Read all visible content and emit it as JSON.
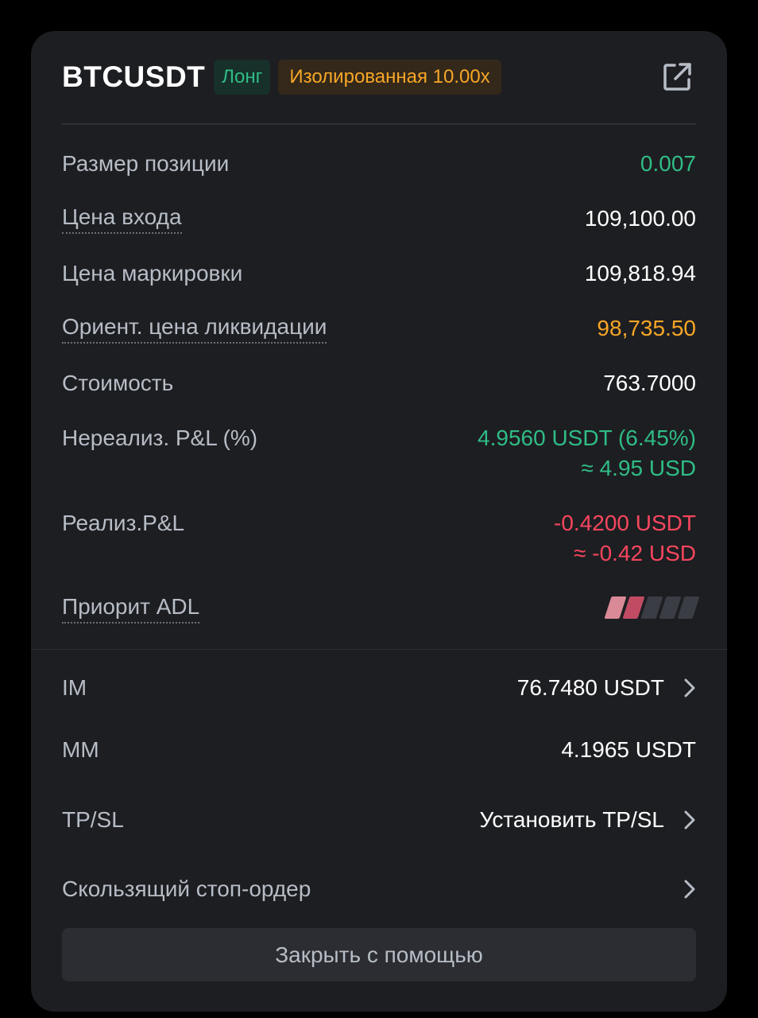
{
  "header": {
    "symbol": "BTCUSDT",
    "side_badge": "Лонг",
    "margin_badge": "Изолированная 10.00x",
    "share_icon": "share-external-icon"
  },
  "details": {
    "position_size": {
      "label": "Размер позиции",
      "value": "0.007"
    },
    "entry_price": {
      "label": "Цена входа",
      "value": "109,100.00"
    },
    "mark_price": {
      "label": "Цена маркировки",
      "value": "109,818.94"
    },
    "liq_price": {
      "label": "Ориент. цена ликвидации",
      "value": "98,735.50"
    },
    "value": {
      "label": "Стоимость",
      "value": "763.7000"
    },
    "unrealized_pnl": {
      "label": "Нереализ. P&L (%)",
      "value": "4.9560 USDT (6.45%)",
      "value_usd": "≈ 4.95 USD"
    },
    "realized_pnl": {
      "label": "Реализ.P&L",
      "value": "-0.4200 USDT",
      "value_usd": "≈ -0.42 USD"
    },
    "adl": {
      "label": "Приорит ADL",
      "level": 2,
      "max_level": 5
    }
  },
  "margin": {
    "im": {
      "label": "IM",
      "value": "76.7480 USDT"
    },
    "mm": {
      "label": "MM",
      "value": "4.1965 USDT"
    },
    "tpsl": {
      "label": "TP/SL",
      "value": "Установить TP/SL"
    },
    "trailing": {
      "label": "Скользящий стоп-ордер"
    }
  },
  "actions": {
    "close_label": "Закрыть с помощью"
  },
  "colors": {
    "green": "#2fbd85",
    "orange": "#f7a626",
    "red": "#f6465d",
    "card_bg": "#1d1e22"
  }
}
